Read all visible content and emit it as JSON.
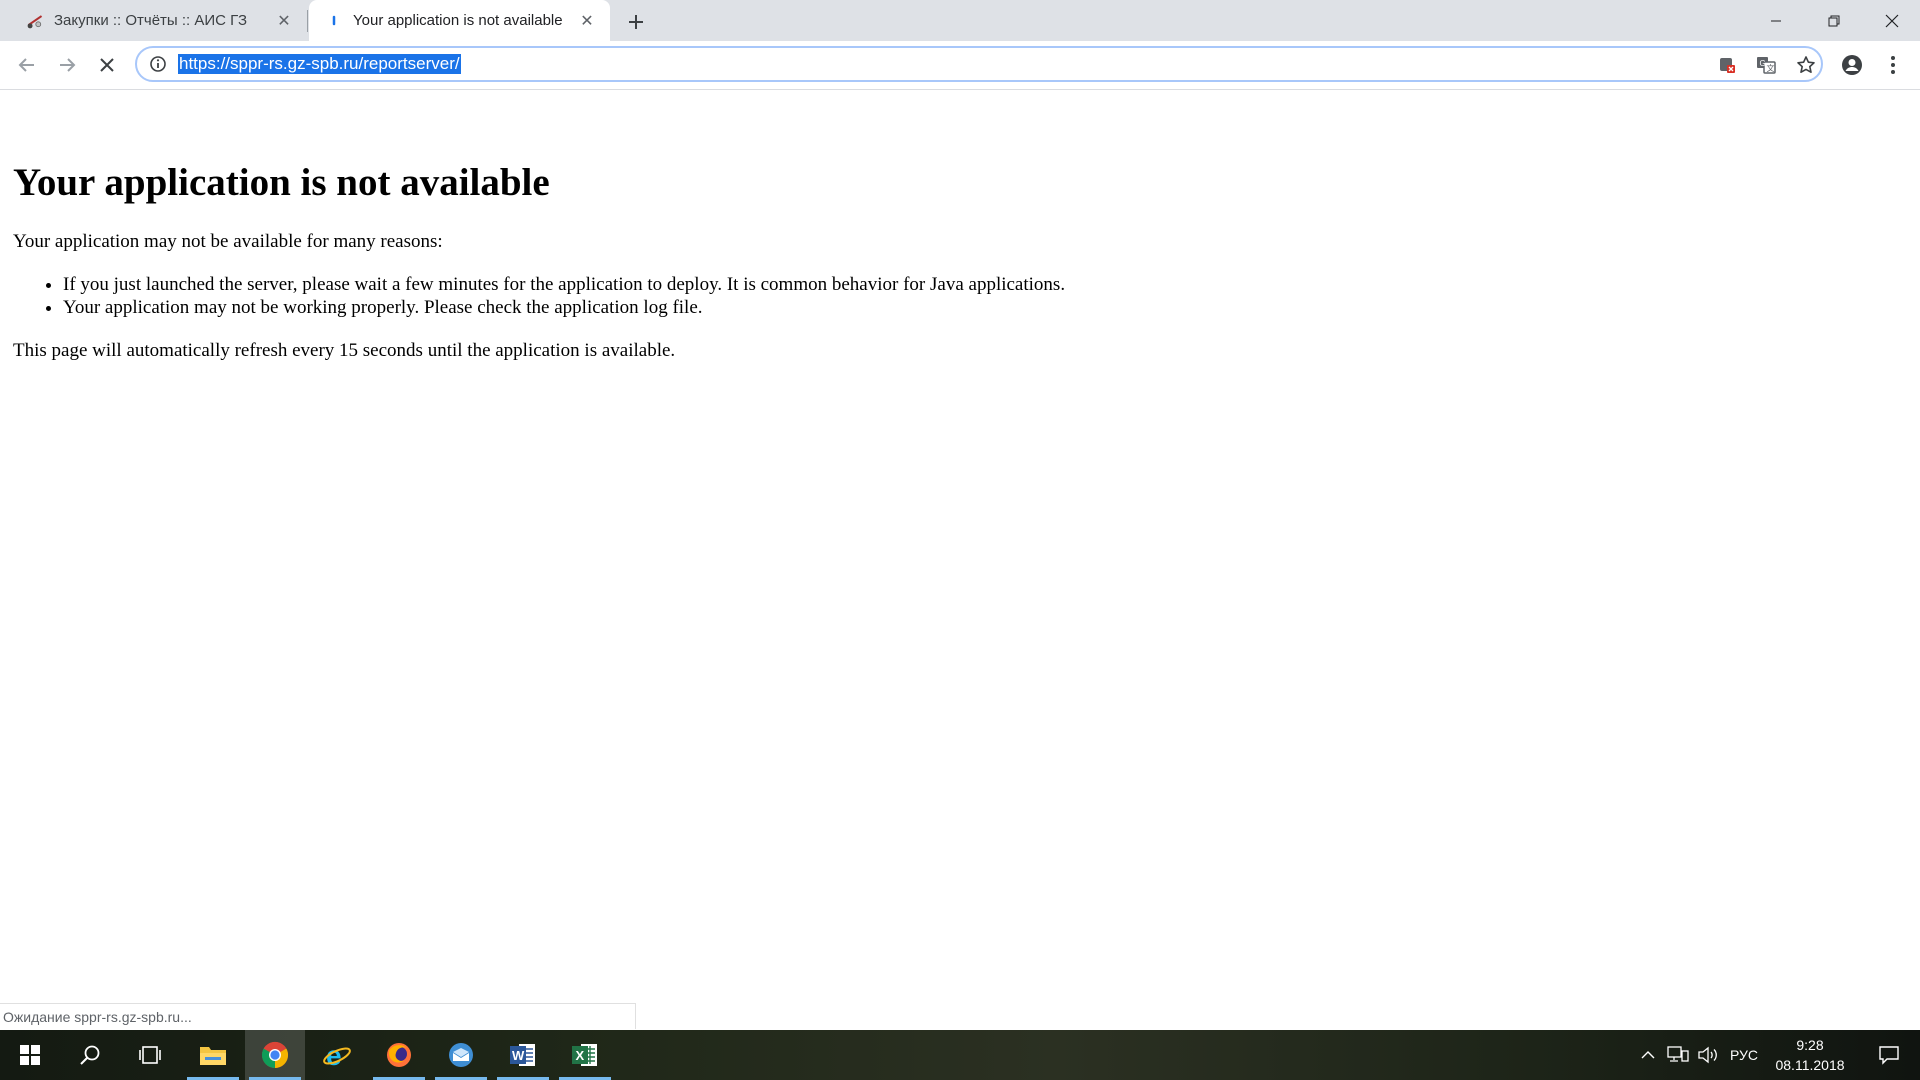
{
  "tabs": [
    {
      "title": "Закупки :: Отчёты :: АИС ГЗ",
      "icon": "scales-icon",
      "active": false
    },
    {
      "title": "Your application is not available",
      "icon": "loading-spinner-icon",
      "active": true
    }
  ],
  "toolbar": {
    "url": "https://sppr-rs.gz-spb.ru/reportserver/",
    "icons": [
      "back-arrow-icon",
      "forward-arrow-icon",
      "stop-loading-icon",
      "info-icon",
      "blocked-popup-icon",
      "translate-icon",
      "star-icon",
      "account-icon",
      "menu-dots-icon"
    ]
  },
  "page": {
    "heading": "Your application is not available",
    "intro": "Your application may not be available for many reasons:",
    "reasons": [
      "If you just launched the server, please wait a few minutes for the application to deploy. It is common behavior for Java applications.",
      "Your application may not be working properly. Please check the application log file."
    ],
    "refresh_note": "This page will automatically refresh every 15 seconds until the application is available."
  },
  "status": {
    "text": "Ожидание sppr-rs.gz-spb.ru..."
  },
  "taskbar": {
    "apps": [
      "windows-start-icon",
      "search-icon",
      "task-view-icon",
      "file-explorer-icon",
      "chrome-icon",
      "internet-explorer-icon",
      "firefox-icon",
      "mail-icon",
      "word-icon",
      "excel-icon"
    ],
    "active_app": "chrome-icon",
    "language": "РУС",
    "time": "9:28",
    "date": "08.11.2018"
  },
  "colors": {
    "tabstrip": "#dee1e6",
    "url_highlight": "#1a73e8",
    "omnibox_border": "#a8c7fa",
    "taskbar_accent": "#76b9ed"
  }
}
